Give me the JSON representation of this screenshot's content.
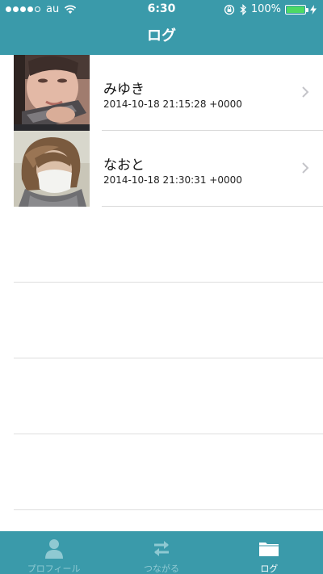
{
  "status_bar": {
    "carrier": "au",
    "time": "6:30",
    "battery": "100%",
    "battery_level": 1.0,
    "signal_bars_filled": 4,
    "signal_bars_total": 5
  },
  "nav": {
    "title": "ログ"
  },
  "log_entries": [
    {
      "name": "みゆき",
      "date": "2014-10-18 21:15:28 +0000"
    },
    {
      "name": "なおと",
      "date": "2014-10-18 21:30:31 +0000"
    }
  ],
  "tabs": [
    {
      "label": "プロフィール",
      "icon": "person-icon",
      "active": false
    },
    {
      "label": "つながる",
      "icon": "swap-arrows-icon",
      "active": false
    },
    {
      "label": "ログ",
      "icon": "folder-icon",
      "active": true
    }
  ],
  "colors": {
    "accent": "#3a9aaa",
    "tab_inactive": "#8fc9d2",
    "battery": "#4cd964"
  }
}
